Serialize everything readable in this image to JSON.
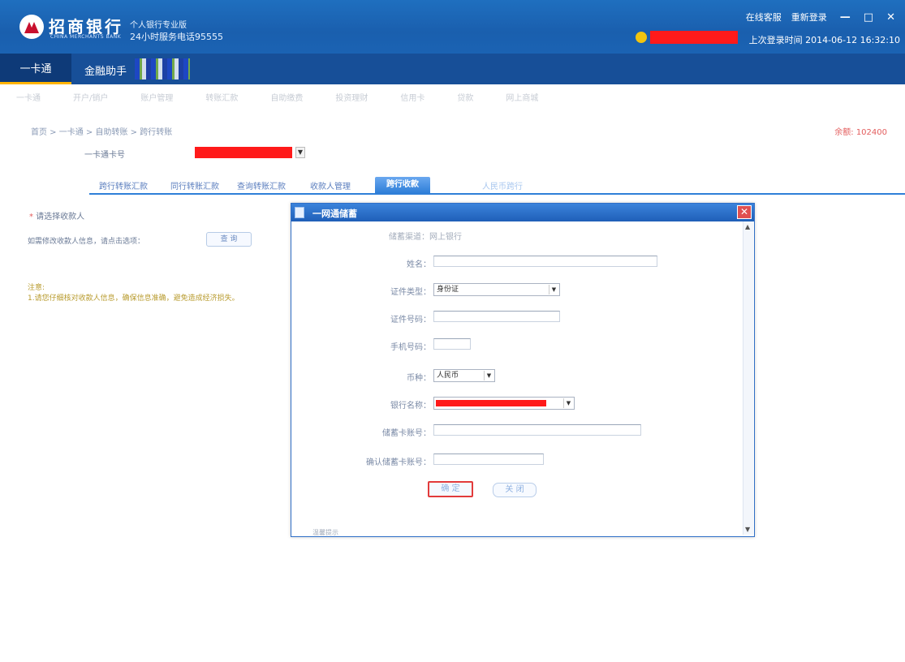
{
  "header": {
    "bank_name": "招商银行",
    "bank_sub": "CHINA MERCHANTS BANK",
    "edition": "个人银行专业版",
    "hotline": "24小时服务电话95555",
    "links": [
      "在线客服",
      "重新登录"
    ],
    "window_controls": [
      "—",
      "□",
      "✕"
    ],
    "last_login": "上次登录时间 2014-06-12 16:32:10"
  },
  "nav": {
    "active": "一卡通",
    "item": "金融助手"
  },
  "subnav": [
    "一卡通",
    "开户/销户",
    "账户管理",
    "转账汇款",
    "自助缴费",
    "投资理财",
    "信用卡",
    "贷款",
    "网上商城"
  ],
  "breadcrumb": "首页 > 一卡通 > 自助转账 > 跨行转账",
  "balance": "余额: 102400",
  "account": {
    "label": "一卡通卡号"
  },
  "tabs": [
    {
      "label": "跨行转账汇款",
      "state": "normal"
    },
    {
      "label": "同行转账汇款",
      "state": "normal"
    },
    {
      "label": "查询转账汇款",
      "state": "normal"
    },
    {
      "label": "收款人管理",
      "state": "normal"
    },
    {
      "label": "跨行收款",
      "state": "active"
    },
    {
      "label": "人民币跨行",
      "state": "muted"
    }
  ],
  "side": {
    "question": "请选择收款人",
    "tip": "如需修改收款人信息，请点击选项：",
    "tip_button": "查 询",
    "note_title": "注意:",
    "note_body": "1.请您仔细核对收款人信息，确保信息准确，避免造成经济损失。"
  },
  "dialog": {
    "title": "一网通储蓄",
    "fields": {
      "static_row": "储蓄渠道：网上银行",
      "name_label": "姓名：",
      "idtype_label": "证件类型：",
      "idtype_value": "身份证",
      "idno_label": "证件号码：",
      "phone_label": "手机号码：",
      "currency_label": "币种：",
      "currency_value": "人民币",
      "bank_label": "银行名称：",
      "account_label": "储蓄卡账号：",
      "confirm_label": "确认储蓄卡账号：",
      "submit": "确 定",
      "close": "关 闭"
    },
    "footer": "温馨提示"
  }
}
